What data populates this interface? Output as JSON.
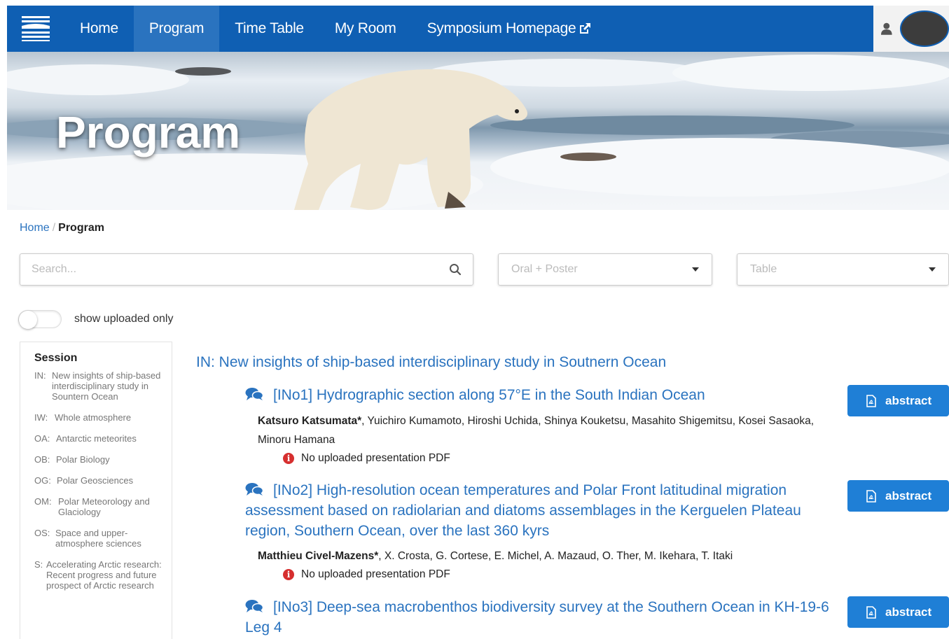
{
  "nav": {
    "items": [
      {
        "label": "Home"
      },
      {
        "label": "Program"
      },
      {
        "label": "Time Table"
      },
      {
        "label": "My Room"
      },
      {
        "label": "Symposium Homepage"
      }
    ],
    "active": "Program"
  },
  "banner": {
    "title": "Program"
  },
  "breadcrumb": {
    "home": "Home",
    "separator": "/",
    "current": "Program"
  },
  "filters": {
    "search_placeholder": "Search...",
    "type_select": "Oral + Poster",
    "view_select": "Table"
  },
  "toggle": {
    "label": "show uploaded only",
    "on": false
  },
  "sidebar": {
    "title": "Session",
    "items": [
      {
        "code": "IN:",
        "name": "New insights of ship-based interdisciplinary study in Sountern Ocean"
      },
      {
        "code": "IW:",
        "name": "Whole atmosphere"
      },
      {
        "code": "OA:",
        "name": "Antarctic meteorites"
      },
      {
        "code": "OB:",
        "name": "Polar Biology"
      },
      {
        "code": "OG:",
        "name": "Polar Geosciences"
      },
      {
        "code": "OM:",
        "name": "Polar Meteorology and Glaciology"
      },
      {
        "code": "OS:",
        "name": "Space and upper-atmosphere sciences"
      },
      {
        "code": "S:",
        "name": "Accelerating Arctic research: Recent progress and future prospect of Arctic research"
      }
    ]
  },
  "program": {
    "session_heading": "IN: New insights of ship-based interdisciplinary study in Soutnern Ocean",
    "talks": [
      {
        "title": "[INo1] Hydrographic section along 57°E in the South Indian Ocean",
        "presenter": "Katsuro Katsumata*",
        "coauthors": ", Yuichiro Kumamoto, Hiroshi Uchida, Shinya Kouketsu, Masahito Shigemitsu, Kosei Sasaoka, Minoru Hamana",
        "pdf_status": "No uploaded presentation PDF",
        "button": "abstract"
      },
      {
        "title": "[INo2] High-resolution ocean temperatures and Polar Front latitudinal migration assessment based on radiolarian and diatoms assemblages in the Kerguelen Plateau region, Southern Ocean, over the last 360 kyrs",
        "presenter": "Matthieu Civel-Mazens*",
        "coauthors": ", X. Crosta, G. Cortese, E. Michel, A. Mazaud, O. Ther, M. Ikehara, T. Itaki",
        "pdf_status": "No uploaded presentation PDF",
        "button": "abstract"
      },
      {
        "title": "[INo3] Deep-sea macrobenthos biodiversity survey at the Southern Ocean in KH-19-6 Leg 4",
        "button": "abstract"
      }
    ]
  },
  "icons": {
    "search": "search-icon",
    "caret": "caret-down-icon",
    "chat": "comments-icon",
    "info": "info-circle-icon",
    "pdf": "file-pdf-icon",
    "user": "user-icon",
    "external": "external-link-icon"
  },
  "colors": {
    "nav_bg": "#0f5fb3",
    "link": "#2a73bf",
    "button": "#1f7fd6",
    "alert": "#d62f2f"
  }
}
